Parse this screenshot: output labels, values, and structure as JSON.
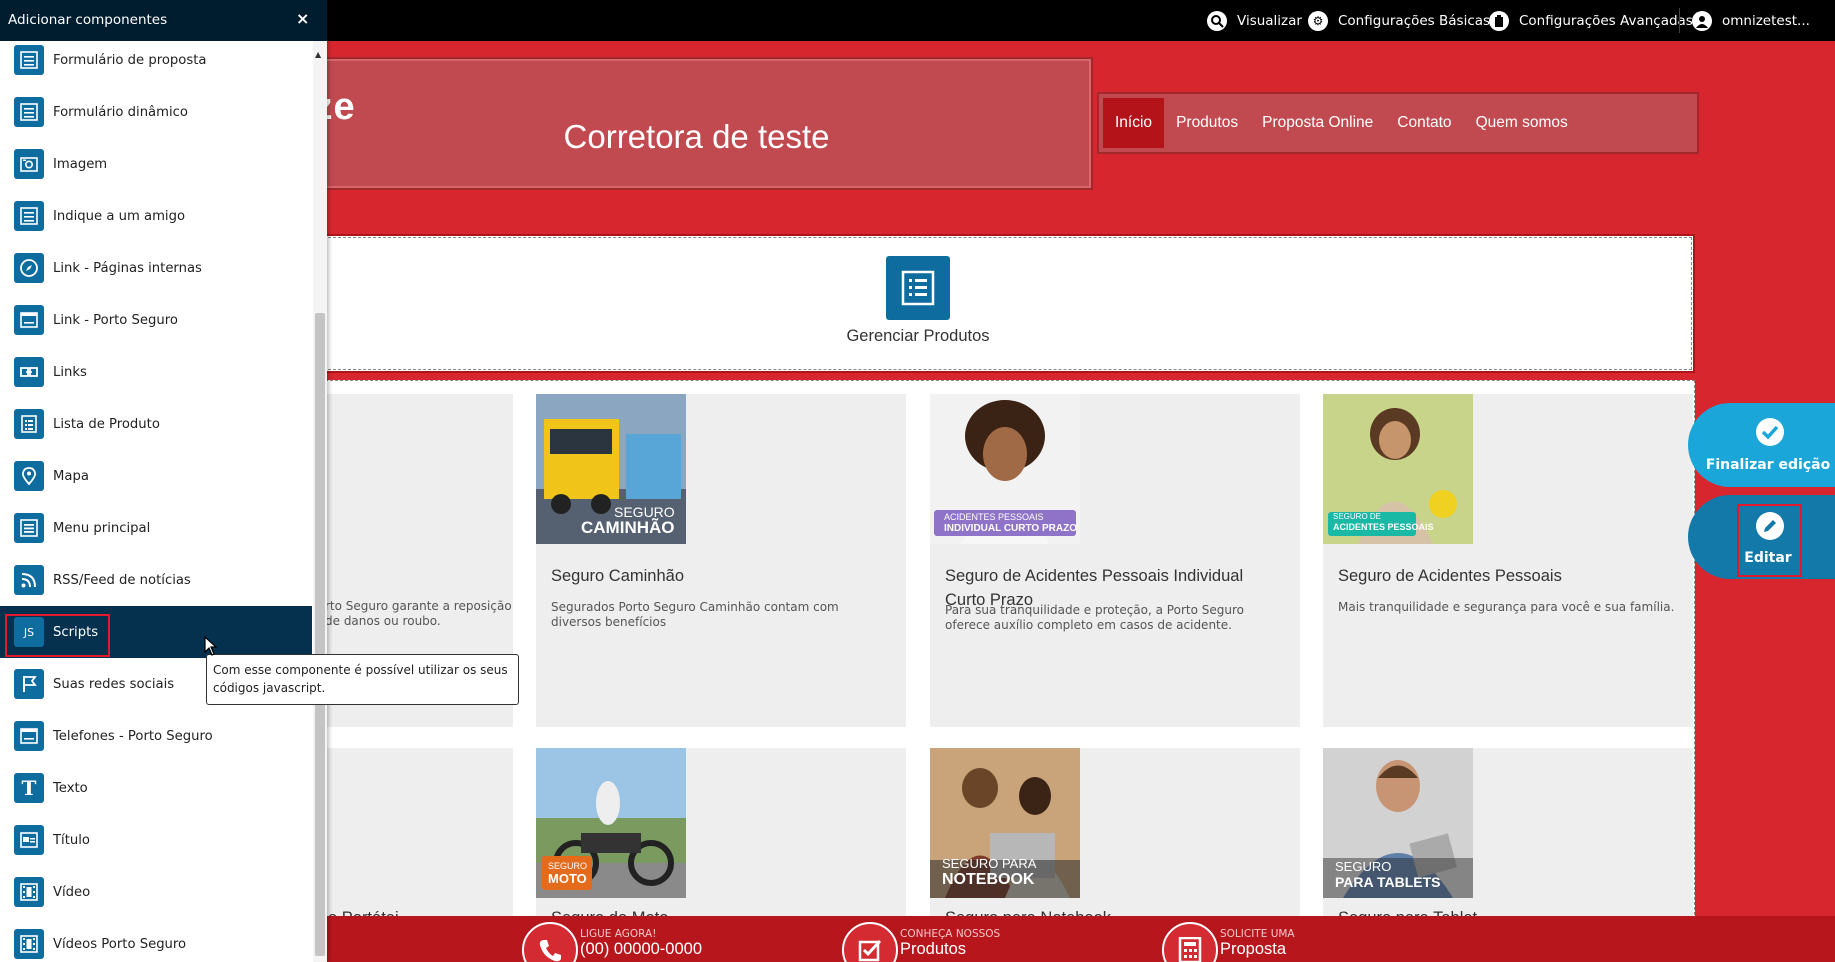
{
  "topbar": {
    "visualizar": "Visualizar",
    "config_basicas": "Configurações Básicas",
    "config_avancadas": "Configurações Avançadas",
    "user": "omnizetest..."
  },
  "header": {
    "logo_fragment": "ize",
    "site_title": "Corretora de teste",
    "nav": [
      "Início",
      "Produtos",
      "Proposta Online",
      "Contato",
      "Quem somos"
    ]
  },
  "manage": {
    "label": "Gerenciar Produtos"
  },
  "products": {
    "row1": [
      {
        "title": "",
        "desc": "rto Seguro garante a reposição de danos ou roubo."
      },
      {
        "title": "Seguro Caminhão",
        "desc": "Segurados Porto Seguro Caminhão contam com diversos benefícios",
        "img_top": "SEGURO",
        "img_bottom": "CAMINHÃO"
      },
      {
        "title": "Seguro de Acidentes Pessoais Individual Curto Prazo",
        "desc": "Para sua tranquilidade e proteção, a Porto Seguro oferece auxílio completo em casos de acidente.",
        "img_top": "ACIDENTES PESSOAIS",
        "img_bottom": "INDIVIDUAL CURTO PRAZO"
      },
      {
        "title": "Seguro de Acidentes Pessoais",
        "desc": "Mais tranquilidade e segurança para você e sua família.",
        "img_top": "SEGURO DE",
        "img_bottom": "ACIDENTES PESSOAIS"
      }
    ],
    "row2": [
      {
        "title": "o Portátei"
      },
      {
        "title": "Seguro de Moto",
        "img_top": "SEGURO",
        "img_bottom": "MOTO"
      },
      {
        "title": "Seguro para Notebook",
        "img_top": "SEGURO PARA",
        "img_bottom": "NOTEBOOK"
      },
      {
        "title": "Seguro para Tablet",
        "img_top": "SEGURO",
        "img_bottom": "PARA TABLETS"
      }
    ]
  },
  "side_buttons": {
    "finalizar": "Finalizar edição",
    "editar": "Editar"
  },
  "footer": [
    {
      "small": "LIGUE AGORA!",
      "big": "(00) 00000-0000",
      "icon": "phone-icon"
    },
    {
      "small": "CONHEÇA NOSSOS",
      "big": "Produtos",
      "icon": "checkbox-icon"
    },
    {
      "small": "SOLICITE UMA",
      "big": "Proposta",
      "icon": "calculator-icon"
    }
  ],
  "sidebar": {
    "title": "Adicionar componentes",
    "close": "×",
    "items": [
      {
        "label": "Formulário de proposta",
        "icon": "form-icon"
      },
      {
        "label": "Formulário dinâmico",
        "icon": "form-icon"
      },
      {
        "label": "Imagem",
        "icon": "camera-icon"
      },
      {
        "label": "Indique a um amigo",
        "icon": "form-icon"
      },
      {
        "label": "Link - Páginas internas",
        "icon": "compass-icon"
      },
      {
        "label": "Link - Porto Seguro",
        "icon": "window-icon"
      },
      {
        "label": "Links",
        "icon": "link-icon"
      },
      {
        "label": "Lista de Produto",
        "icon": "list-icon"
      },
      {
        "label": "Mapa",
        "icon": "map-pin-icon"
      },
      {
        "label": "Menu principal",
        "icon": "menu-icon"
      },
      {
        "label": "RSS/Feed de notícias",
        "icon": "rss-icon"
      },
      {
        "label": "Scripts",
        "icon": "js-icon",
        "glyph": "JS"
      },
      {
        "label": "Suas redes sociais",
        "icon": "flag-icon"
      },
      {
        "label": "Telefones - Porto Seguro",
        "icon": "window-icon"
      },
      {
        "label": "Texto",
        "icon": "text-icon",
        "glyph": "T"
      },
      {
        "label": "Título",
        "icon": "title-icon"
      },
      {
        "label": "Vídeo",
        "icon": "film-icon"
      },
      {
        "label": "Vídeos Porto Seguro",
        "icon": "film-icon"
      }
    ]
  },
  "tooltip": {
    "text": "Com esse componente é possível utilizar os seus códigos javascript."
  },
  "colors": {
    "brand_red": "#d8262f",
    "dark_navy": "#001d30",
    "icon_blue": "#0e6c9e",
    "highlight": "#e2182b"
  }
}
